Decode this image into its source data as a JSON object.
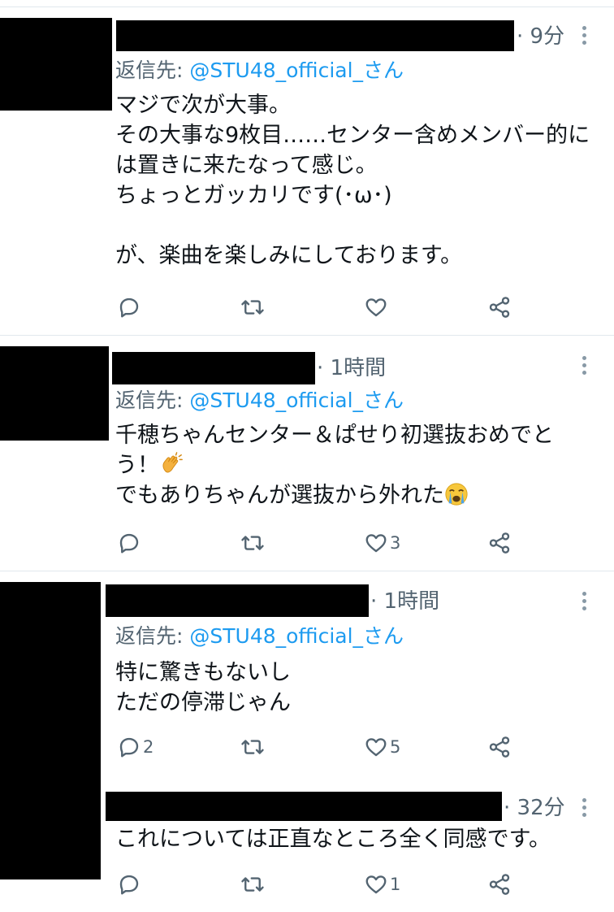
{
  "tweets": [
    {
      "time": "· 9分",
      "reply_to_label": "返信先: ",
      "reply_to_handle": "@STU48_official_さん",
      "text": "マジで次が大事。\nその大事な9枚目……センター含めメンバー的には置きに来たなって感じ。\nちょっとガッカリです(･ω･)\n\nが、楽曲を楽しみにしております。",
      "counts": {
        "reply": "",
        "retweet": "",
        "like": ""
      }
    },
    {
      "time": "· 1時間",
      "reply_to_label": "返信先: ",
      "reply_to_handle": "@STU48_official_さん",
      "text_line1": "千穂ちゃんセンター＆ぱせり初選抜おめでと",
      "text_line2": "う！",
      "text_line3": "でもありちゃんが選抜から外れた",
      "counts": {
        "reply": "",
        "retweet": "",
        "like": "3"
      }
    },
    {
      "time": "· 1時間",
      "reply_to_label": "返信先: ",
      "reply_to_handle": "@STU48_official_さん",
      "text": "特に驚きもないし\nただの停滞じゃん",
      "counts": {
        "reply": "2",
        "retweet": "",
        "like": "5"
      }
    },
    {
      "time": "· 32分",
      "text": "これについては正直なところ全く同感です。",
      "counts": {
        "reply": "",
        "retweet": "",
        "like": "1"
      }
    }
  ],
  "icons": [
    "reply-icon",
    "retweet-icon",
    "like-icon",
    "share-icon",
    "more-icon",
    "clap-emoji",
    "crying-emoji"
  ],
  "colors": {
    "link": "#1d9bf0",
    "meta": "#536471",
    "icon": "#536471",
    "divider": "#e1e8ed"
  }
}
